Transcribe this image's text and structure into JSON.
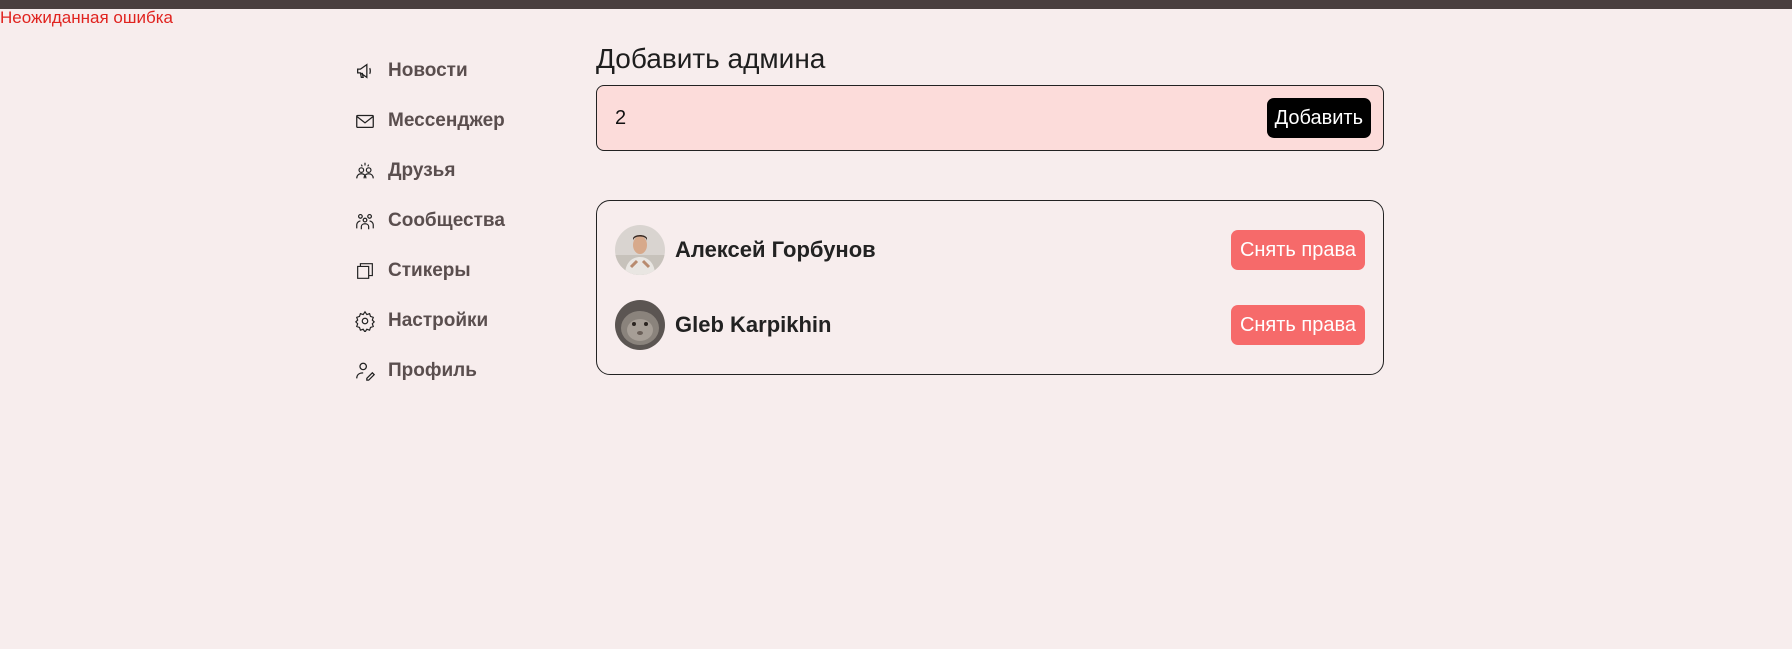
{
  "error": {
    "text": "Неожиданная ошибка",
    "color": "#e0231f"
  },
  "sidebar": {
    "items": [
      {
        "label": "Новости",
        "icon": "megaphone-icon"
      },
      {
        "label": "Мессенджер",
        "icon": "envelope-icon"
      },
      {
        "label": "Друзья",
        "icon": "friends-icon"
      },
      {
        "label": "Сообщества",
        "icon": "community-icon"
      },
      {
        "label": "Стикеры",
        "icon": "sticker-icon"
      },
      {
        "label": "Настройки",
        "icon": "gear-icon"
      },
      {
        "label": "Профиль",
        "icon": "profile-edit-icon"
      }
    ]
  },
  "main": {
    "title": "Добавить админа",
    "add_form": {
      "input_value": "2",
      "button_label": "Добавить"
    },
    "admins": [
      {
        "name": "Алексей Горбунов",
        "button_label": "Снять права"
      },
      {
        "name": "Gleb Karpikhin",
        "button_label": "Снять права"
      }
    ]
  },
  "colors": {
    "background": "#f7eded",
    "topbar": "#4a3f3f",
    "add_box": "#fcdcda",
    "revoke_button": "#f66a6a",
    "add_button": "#000000"
  }
}
